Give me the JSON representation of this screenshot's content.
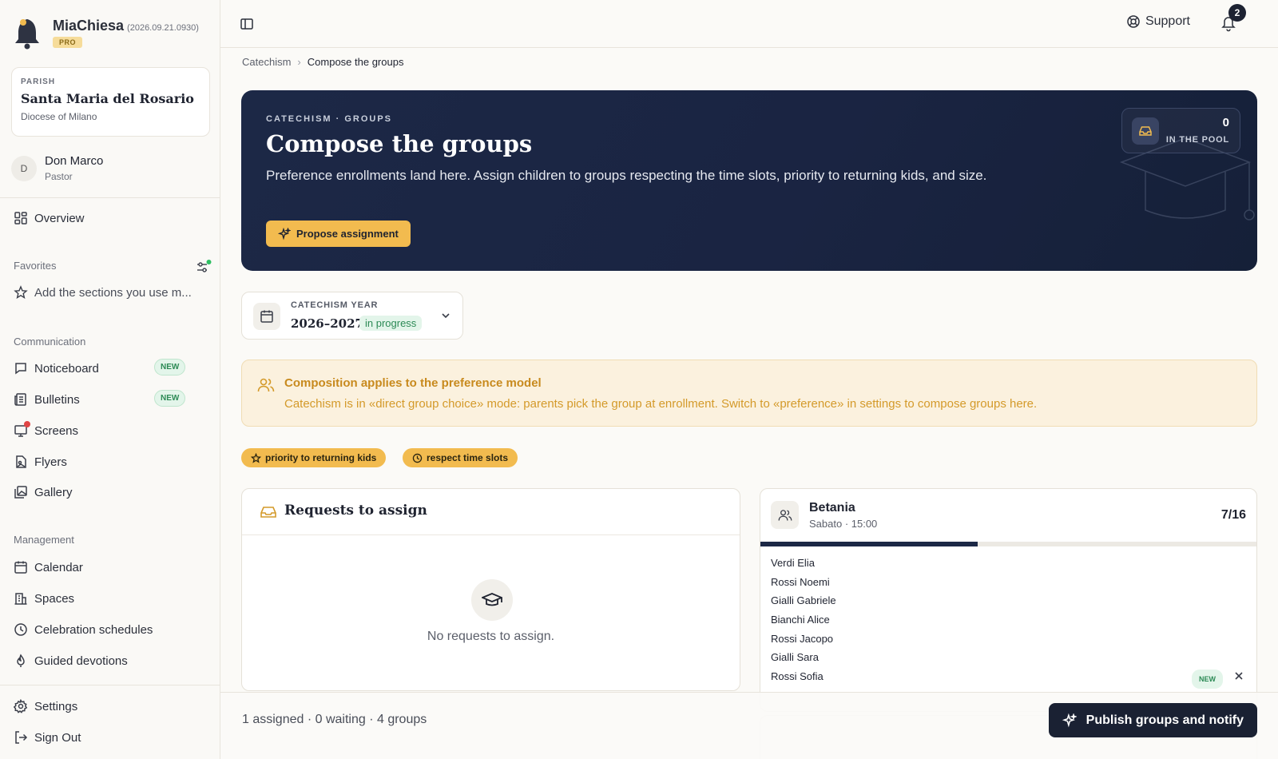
{
  "app": {
    "name": "MiaChiesa",
    "version": "(2026.09.21.0930)",
    "plan": "PRO"
  },
  "parish": {
    "label": "PARISH",
    "name": "Santa Maria del Rosario",
    "diocese": "Diocese of Milano"
  },
  "user": {
    "initial": "D",
    "name": "Don Marco",
    "role": "Pastor"
  },
  "sidebar": {
    "overview": "Overview",
    "favorites_label": "Favorites",
    "favorites_add": "Add the sections you use m...",
    "communication_label": "Communication",
    "communication": [
      {
        "label": "Noticeboard",
        "badge": "NEW"
      },
      {
        "label": "Bulletins",
        "badge": "NEW"
      },
      {
        "label": "Screens"
      },
      {
        "label": "Flyers"
      },
      {
        "label": "Gallery"
      }
    ],
    "management_label": "Management",
    "management": [
      {
        "label": "Calendar"
      },
      {
        "label": "Spaces"
      },
      {
        "label": "Celebration schedules"
      },
      {
        "label": "Guided devotions"
      }
    ],
    "settings": "Settings",
    "signout": "Sign Out"
  },
  "topbar": {
    "support": "Support",
    "notifications": "2"
  },
  "breadcrumb": {
    "parent": "Catechism",
    "current": "Compose the groups"
  },
  "hero": {
    "kicker": "CATECHISM · GROUPS",
    "title": "Compose the groups",
    "description": "Preference enrollments land here. Assign children to groups respecting the time slots, priority to returning kids, and size.",
    "propose": "Propose assignment",
    "pool_count": "0",
    "pool_label": "IN THE POOL"
  },
  "year": {
    "label": "CATECHISM YEAR",
    "value": "2026–2027",
    "status": "in progress"
  },
  "notice": {
    "title": "Composition applies to the preference model",
    "text": "Catechism is in «direct group choice» mode: parents pick the group at enrollment. Switch to «preference» in settings to compose groups here."
  },
  "chips": {
    "priority": "priority to returning kids",
    "slots": "respect time slots"
  },
  "requests": {
    "title": "Requests to assign",
    "empty": "No requests to assign."
  },
  "group": {
    "name": "Betania",
    "slot": "Sabato · 15:00",
    "count": "7/16",
    "fill": 0.4375,
    "members": [
      {
        "name": "Verdi Elia"
      },
      {
        "name": "Rossi Noemi"
      },
      {
        "name": "Gialli Gabriele"
      },
      {
        "name": "Bianchi Alice"
      },
      {
        "name": "Rossi Jacopo"
      },
      {
        "name": "Gialli Sara"
      },
      {
        "name": "Rossi Sofia",
        "badge": "NEW"
      }
    ]
  },
  "footer": {
    "stats": "1 assigned · 0 waiting · 4 groups",
    "publish": "Publish groups and notify"
  },
  "colors": {
    "navy": "#1c2846",
    "accent": "#f2bb4f",
    "success": "#2c8a55",
    "warning": "#c88a1e"
  }
}
